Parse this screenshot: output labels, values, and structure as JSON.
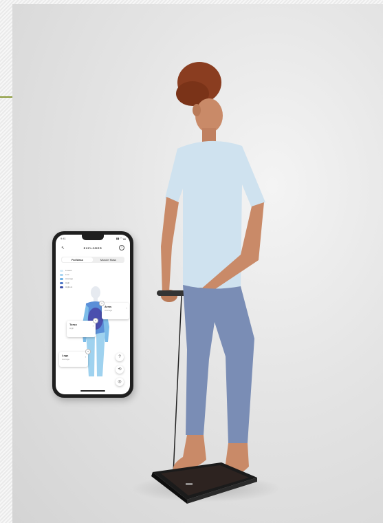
{
  "phone": {
    "status_time": "9:41",
    "status_icons": "▮▮ ◠ ▬",
    "screen_title": "EXPLORER",
    "tabs": [
      {
        "label": "Fat Mass",
        "selected": true
      },
      {
        "label": "Muscle Mass",
        "selected": false
      }
    ],
    "legend": [
      {
        "label": "Lowest",
        "color": "#d6ecf8"
      },
      {
        "label": "Low",
        "color": "#a9d5f2"
      },
      {
        "label": "Average",
        "color": "#6fb3e6"
      },
      {
        "label": "High",
        "color": "#4f78c8"
      },
      {
        "label": "Highest",
        "color": "#3c4fa8"
      }
    ],
    "callouts": {
      "arms": {
        "title": "Arms",
        "subtitle": "Average"
      },
      "torso": {
        "title": "Torso",
        "subtitle": "High"
      },
      "legs": {
        "title": "Legs",
        "subtitle": "Average"
      }
    },
    "buttons": {
      "help": "?",
      "rotate": "⟲",
      "target": "◎"
    }
  },
  "colors": {
    "shirt": "#cfe2ef",
    "leggings": "#7a8db5",
    "skin": "#c98a68",
    "hair": "#8a3d20",
    "scale": "#1b1b1b",
    "accent_line": "#8a9a3a"
  }
}
